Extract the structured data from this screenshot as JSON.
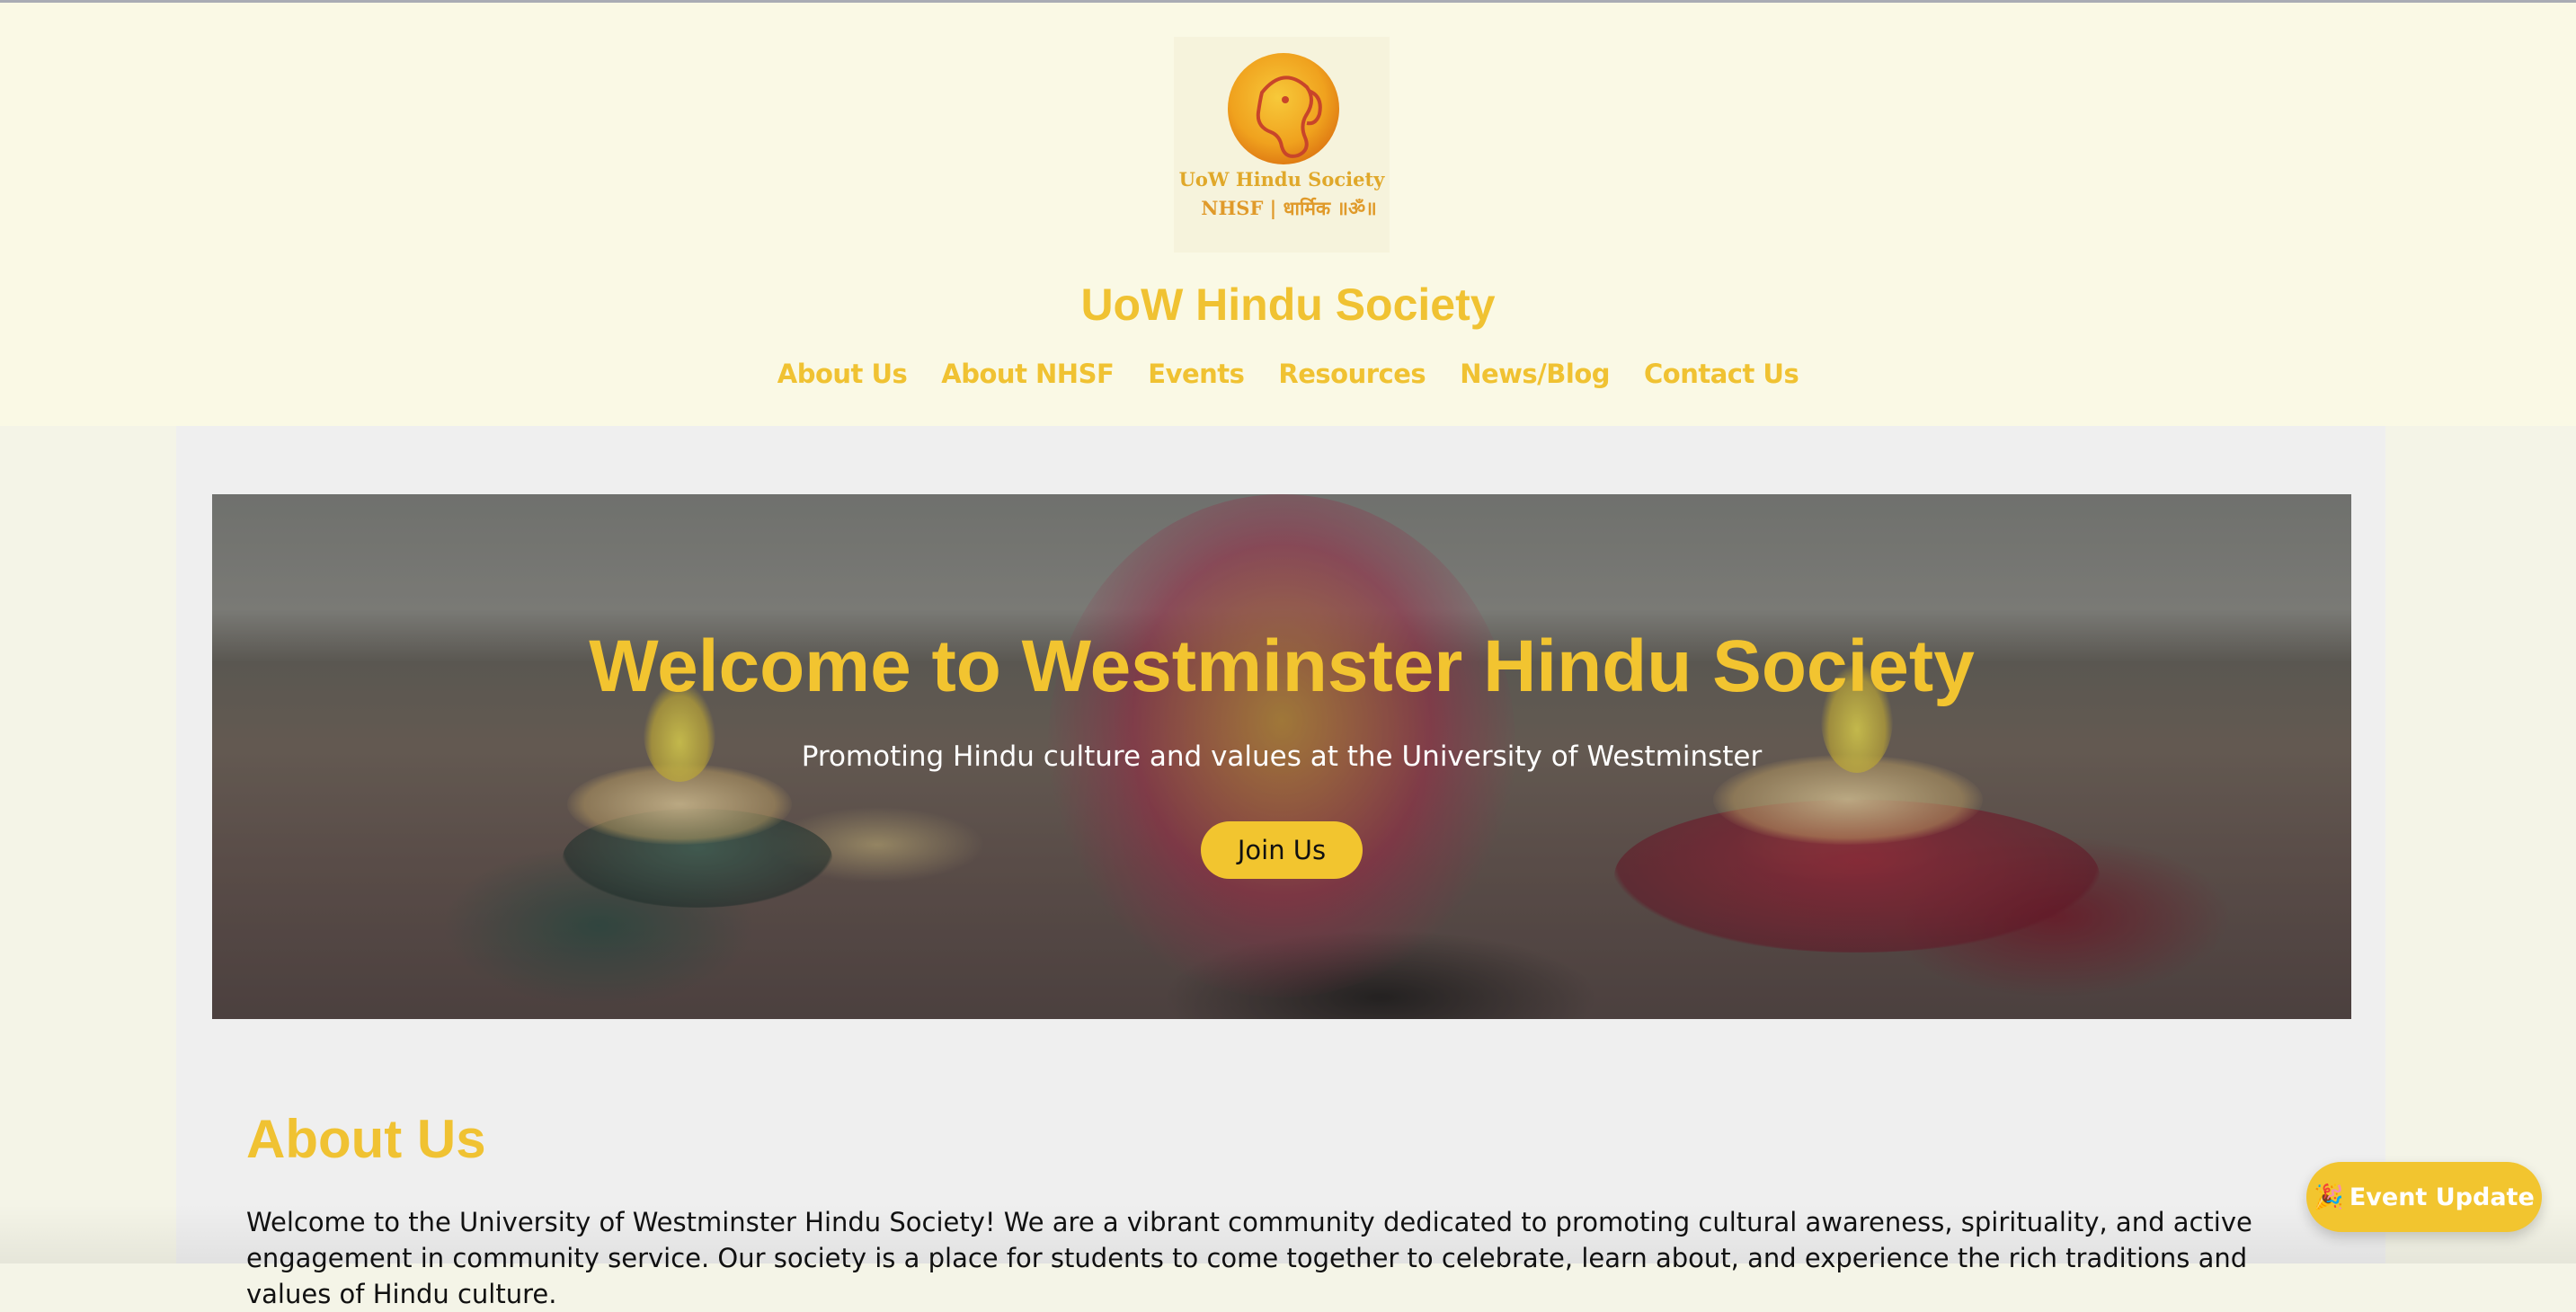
{
  "header": {
    "logo": {
      "line1": "UoW Hindu Society",
      "line2": "NHSF | धार्मिक ॥ॐ॥"
    },
    "site_title": "UoW Hindu Society",
    "nav": [
      {
        "label": "About Us"
      },
      {
        "label": "About NHSF"
      },
      {
        "label": "Events"
      },
      {
        "label": "Resources"
      },
      {
        "label": "News/Blog"
      },
      {
        "label": "Contact Us"
      }
    ]
  },
  "hero": {
    "title": "Welcome to Westminster Hindu Society",
    "subtitle": "Promoting Hindu culture and values at the University of Westminster",
    "cta_label": "Join Us"
  },
  "about": {
    "heading": "About Us",
    "text": "Welcome to the University of Westminster Hindu Society! We are a vibrant community dedicated to promoting cultural awareness, spirituality, and active engagement in community service. Our society is a place for students to come together to celebrate, learn about, and experience the rich traditions and values of Hindu culture."
  },
  "event_update": {
    "icon": "party-popper-icon",
    "emoji": "🎉",
    "label": "Event Update"
  },
  "colors": {
    "accent": "#f0c232",
    "header_bg": "#faf9e5",
    "panel_bg": "#efefef"
  }
}
